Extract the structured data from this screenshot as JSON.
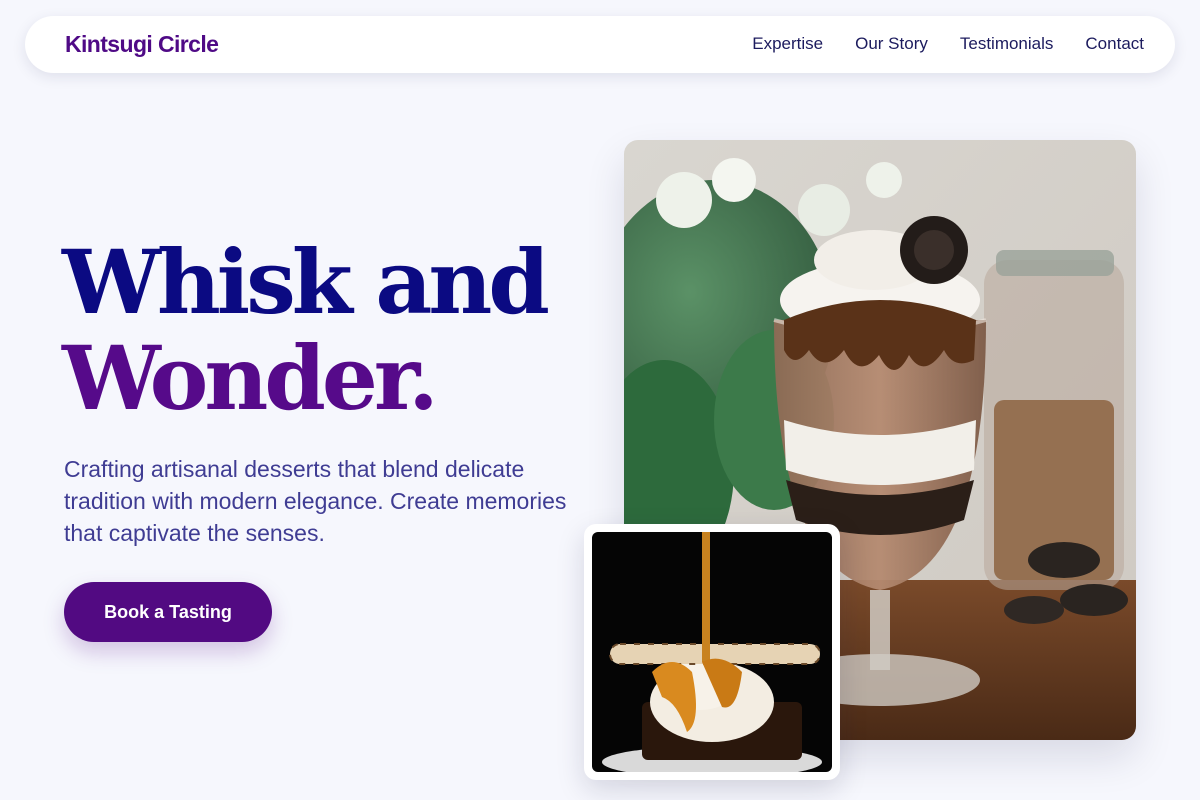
{
  "nav": {
    "brand": "Kintsugi Circle",
    "links": [
      "Expertise",
      "Our Story",
      "Testimonials",
      "Contact"
    ]
  },
  "hero": {
    "title_line1": "Whisk and",
    "title_line2": "Wonder.",
    "subtitle": "Crafting artisanal desserts that blend delicate tradition with modern elegance. Create memories that captivate the senses.",
    "cta_label": "Book a Tasting"
  },
  "colors": {
    "background": "#f6f7fd",
    "brand": "#4f0a86",
    "title_primary": "#0b0a82",
    "title_secondary": "#560a8a",
    "subtitle": "#3f3c93",
    "cta_bg": "#520a82"
  },
  "images": {
    "main": "chocolate-parfait-photo",
    "secondary": "caramel-ice-cream-brownie-photo"
  }
}
